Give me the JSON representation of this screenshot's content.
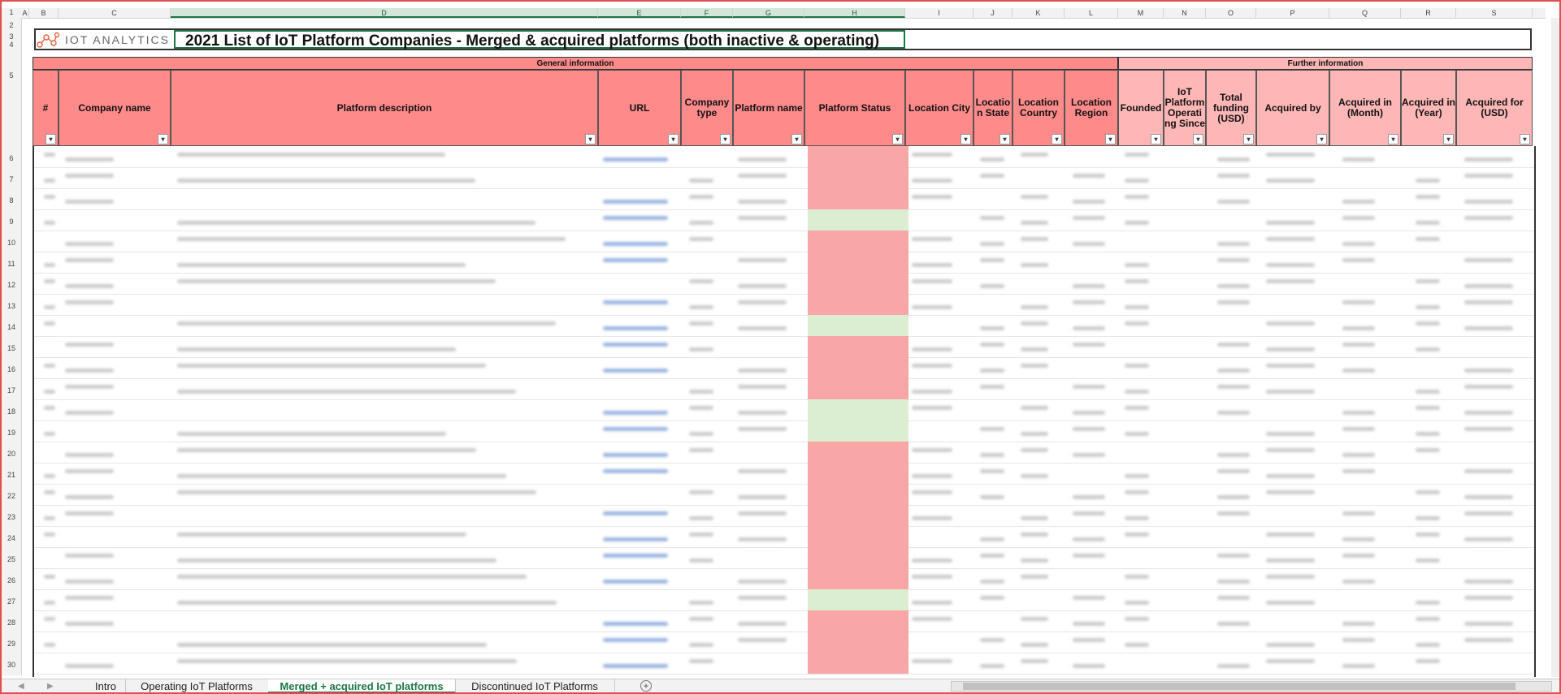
{
  "column_letters": [
    "A",
    "B",
    "C",
    "D",
    "E",
    "F",
    "G",
    "H",
    "I",
    "J",
    "K",
    "L",
    "M",
    "N",
    "O",
    "P",
    "Q",
    "R",
    "S"
  ],
  "row_numbers": [
    "1",
    "2",
    "3",
    "4",
    "5",
    "6",
    "7",
    "8",
    "9",
    "10",
    "11",
    "12",
    "13",
    "14",
    "15",
    "16",
    "17",
    "18",
    "19",
    "20",
    "21",
    "22",
    "23",
    "24",
    "25",
    "26",
    "27",
    "28",
    "29",
    "30"
  ],
  "logo": {
    "text": "IOT ANALYTICS"
  },
  "sheet_title": "2021 List of IoT Platform Companies - Merged & acquired platforms (both inactive & operating)",
  "groups": {
    "general": "General information",
    "further": "Further information"
  },
  "headers": {
    "num": "#",
    "company_name": "Company name",
    "platform_description": "Platform description",
    "url": "URL",
    "company_type": "Company type",
    "platform_name": "Platform name",
    "platform_status": "Platform Status",
    "location_city": "Location City",
    "location_state": "Locatio n State",
    "location_country": "Location Country",
    "location_region": "Location Region",
    "founded": "Founded",
    "iot_since": "IoT Platform Operati ng Since",
    "total_funding": "Total funding (USD)",
    "acquired_by": "Acquired by",
    "acquired_month": "Acquired in (Month)",
    "acquired_year": "Acquired in (Year)",
    "acquired_for": "Acquired for (USD)"
  },
  "filter_glyph": "▾",
  "tabs": [
    {
      "label": "Intro",
      "active": false
    },
    {
      "label": "Operating IoT Platforms",
      "active": false
    },
    {
      "label": "Merged + acquired IoT platforms",
      "active": true
    },
    {
      "label": "Discontinued IoT Platforms",
      "active": false
    }
  ],
  "tab_nav": {
    "prev": "◀",
    "next": "▶",
    "add": "+"
  },
  "colors": {
    "header_red": "#ff8a8a",
    "header_pink": "#ffb6b6",
    "status_inactive": "#f8a6a6",
    "status_operating": "#dbeed2",
    "accent_green": "#217346",
    "frame_red": "#e24d4d"
  },
  "status_rows": [
    "red",
    "red",
    "red",
    "green",
    "red",
    "red",
    "red",
    "red",
    "green",
    "red",
    "red",
    "red",
    "green",
    "green",
    "red",
    "red",
    "red",
    "red",
    "red",
    "red",
    "red",
    "green",
    "red",
    "red",
    "red"
  ]
}
